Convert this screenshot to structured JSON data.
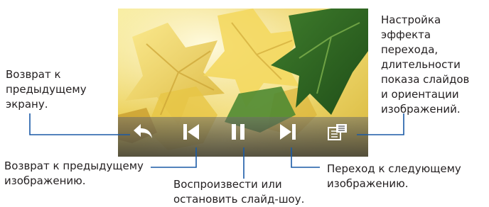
{
  "callouts": {
    "back_screen": "Возврат к\nпредыдущему\nэкрану.",
    "settings": "Настройка\nэффекта перехода,\nдлительности\nпоказа слайдов\nи ориентации\nизображений.",
    "previous_image": "Возврат к предыдущему\nизображению.",
    "play_pause": "Воспроизвести или\nостановить слайд-шоу.",
    "next_image": "Переход к следующему\nизображению."
  },
  "toolbar": {
    "buttons": [
      {
        "icon": "back-arrow-icon"
      },
      {
        "icon": "skip-previous-icon"
      },
      {
        "icon": "pause-icon"
      },
      {
        "icon": "skip-next-icon"
      },
      {
        "icon": "menu-list-icon"
      }
    ]
  },
  "colors": {
    "leader_line": "#1a5aa6",
    "text": "#231f20",
    "toolbar_icon": "#ffffff"
  }
}
